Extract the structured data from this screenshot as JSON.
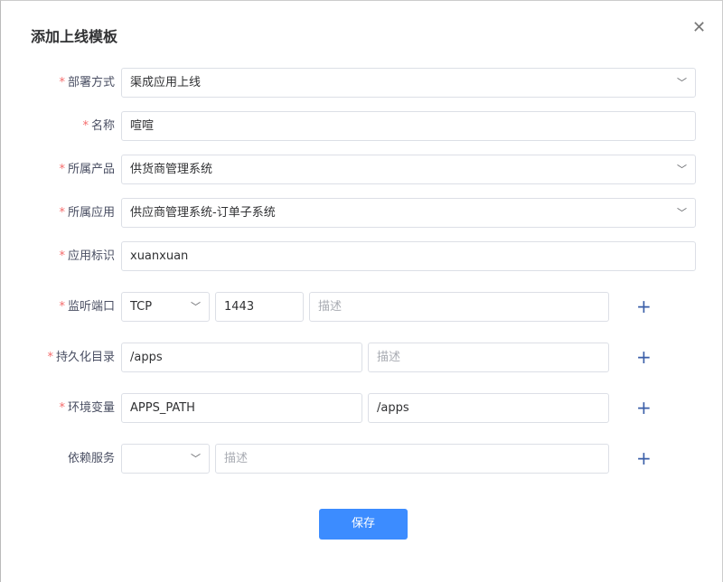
{
  "title": "添加上线模板",
  "fields": {
    "deploy": {
      "label": "部署方式",
      "value": "渠成应用上线"
    },
    "name": {
      "label": "名称",
      "value": "喧喧"
    },
    "product": {
      "label": "所属产品",
      "value": "供货商管理系统"
    },
    "app": {
      "label": "所属应用",
      "value": "供应商管理系统-订单子系统"
    },
    "app_id": {
      "label": "应用标识",
      "value": "xuanxuan"
    },
    "port": {
      "label": "监听端口",
      "protocol": "TCP",
      "port": "1443",
      "desc_placeholder": "描述"
    },
    "persist": {
      "label": "持久化目录",
      "path": "/apps",
      "desc_placeholder": "描述"
    },
    "env": {
      "label": "环境变量",
      "key": "APPS_PATH",
      "value": "/apps"
    },
    "deps": {
      "label": "依赖服务",
      "service": "",
      "desc_placeholder": "描述"
    }
  },
  "required_mark": "*",
  "save_label": "保存"
}
